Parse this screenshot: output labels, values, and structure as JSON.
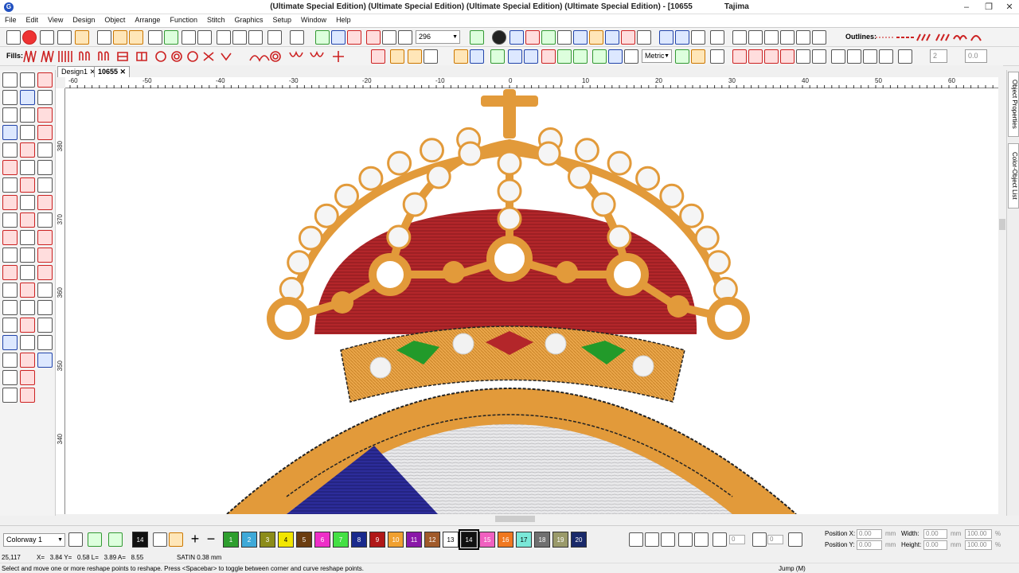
{
  "window": {
    "title": "(Ultimate Special Edition) (Ultimate Special Edition) (Ultimate Special Edition) (Ultimate Special Edition) - [10655",
    "machine": "Tajima",
    "min": "–",
    "restore": "❐",
    "close": "✕"
  },
  "menu": [
    "File",
    "Edit",
    "View",
    "Design",
    "Object",
    "Arrange",
    "Function",
    "Stitch",
    "Graphics",
    "Setup",
    "Window",
    "Help"
  ],
  "toolbar": {
    "zoom_value": "296",
    "outlines_label": "Outlines:",
    "fills_label": "Fills:",
    "units": "Metric",
    "spin1": "2",
    "spin2": "0.0"
  },
  "tabs": [
    "Design1",
    "10655"
  ],
  "rulers": {
    "h_labels": [
      "-60",
      "-50",
      "-40",
      "-30",
      "-20",
      "-10",
      "0",
      "10",
      "20",
      "30",
      "40",
      "50",
      "60"
    ],
    "v_labels": [
      "380",
      "370",
      "360",
      "350",
      "340"
    ]
  },
  "right_panel": [
    "Object Properties",
    "Color-Object List"
  ],
  "colorway": {
    "name": "Colorway 1",
    "active": "14",
    "swatches": [
      {
        "n": "1",
        "c": "#2e9e2e"
      },
      {
        "n": "2",
        "c": "#3fa9d8"
      },
      {
        "n": "3",
        "c": "#8c8c1a"
      },
      {
        "n": "4",
        "c": "#f2e600"
      },
      {
        "n": "5",
        "c": "#6b3d10"
      },
      {
        "n": "6",
        "c": "#ee2ec8"
      },
      {
        "n": "7",
        "c": "#44e044"
      },
      {
        "n": "8",
        "c": "#1a2a8c"
      },
      {
        "n": "9",
        "c": "#b01818"
      },
      {
        "n": "10",
        "c": "#f0a030"
      },
      {
        "n": "11",
        "c": "#8a18a8"
      },
      {
        "n": "12",
        "c": "#a05a2a"
      },
      {
        "n": "13",
        "c": "#ffffff"
      },
      {
        "n": "14",
        "c": "#111111"
      },
      {
        "n": "15",
        "c": "#f060c0"
      },
      {
        "n": "16",
        "c": "#f07820"
      },
      {
        "n": "17",
        "c": "#7ae8d8"
      },
      {
        "n": "18",
        "c": "#707070"
      },
      {
        "n": "19",
        "c": "#9a9a6a"
      },
      {
        "n": "20",
        "c": "#1a2a6a"
      }
    ]
  },
  "position": {
    "x_label": "Position X:",
    "y_label": "Position Y:",
    "x": "0.00",
    "y": "0.00",
    "unit": "mm",
    "w_label": "Width:",
    "h_label": "Height:",
    "w": "0.00",
    "h": "0.00",
    "pct_w": "100.00",
    "pct_h": "100.00",
    "pct": "%",
    "rot": "0",
    "slant": "0"
  },
  "status_info": {
    "stitches": "25,117",
    "coords": "X=   3.84 Y=   0.58 L=   3.89 A=   8.55",
    "stitch_type": "SATIN  0.38 mm"
  },
  "status_bar": {
    "hint": "Select and move one or more reshape points to reshape. Press <Spacebar> to toggle between corner and curve reshape points.",
    "mode": "Jump (M)"
  }
}
